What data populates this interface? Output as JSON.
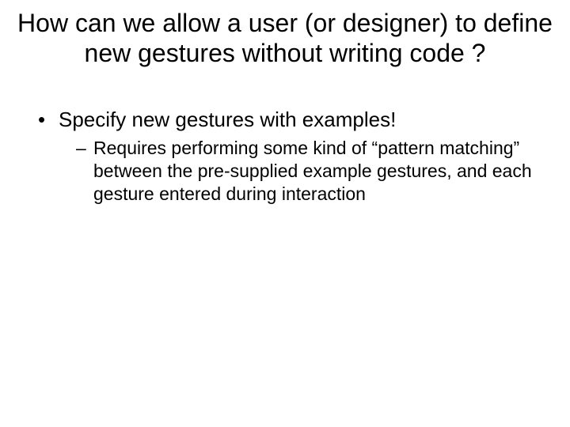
{
  "slide": {
    "title": "How can we allow a user (or designer) to define new gestures without writing code ?",
    "bullets": [
      {
        "text": "Specify new gestures with examples!",
        "children": [
          "Requires performing some kind of “pattern matching” between the pre-supplied example gestures, and each gesture entered during interaction"
        ]
      }
    ]
  }
}
